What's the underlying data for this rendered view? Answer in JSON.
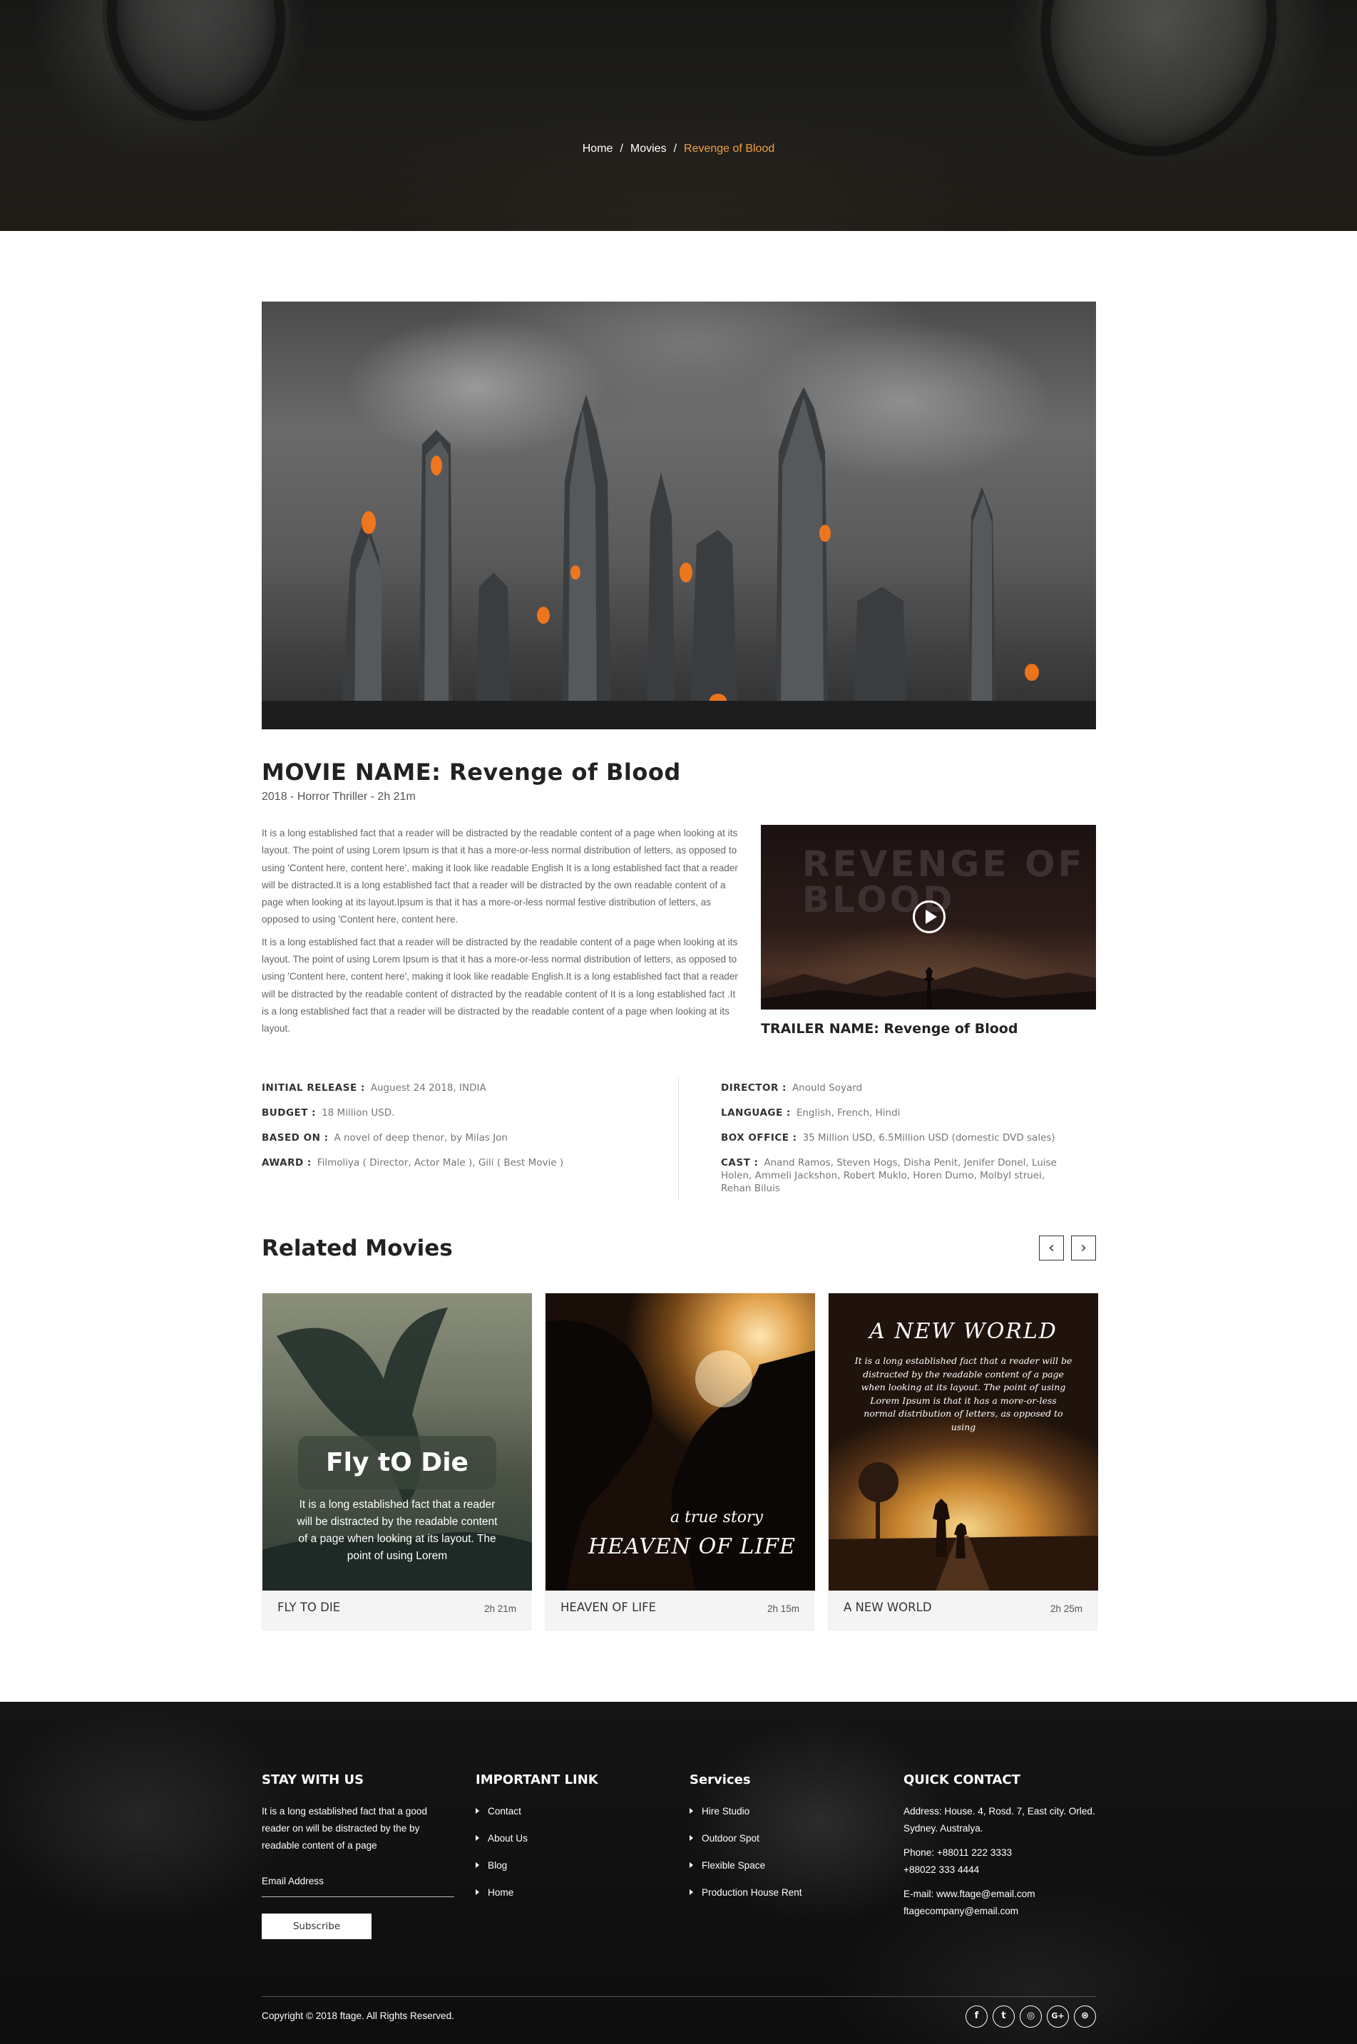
{
  "breadcrumb": {
    "home": "Home",
    "movies": "Movies",
    "current": "Revenge of Blood",
    "separator": "/",
    "active_color": "#f0a040"
  },
  "movie": {
    "title": "MOVIE NAME: Revenge of Blood",
    "meta": "2018 - Horror Thriller - 2h 21m",
    "description": [
      "It is a long established fact that a reader will be distracted by the readable content of a page when looking at its layout. The point of using Lorem Ipsum is that it has a more-or-less normal distribution of letters, as opposed to using 'Content here, content here', making it look like readable English It is a long established fact that a reader will be distracted.It is a long established fact that a reader will be distracted by the own readable content of a page when looking at its layout.Ipsum is that it has a more-or-less normal festive distribution of letters, as opposed to using 'Content here, content here.",
      "It is a long established fact that a reader will be distracted by the readable content of a page when looking at its layout. The point of using Lorem Ipsum is that it has a more-or-less normal distribution of letters, as opposed to using 'Content here, content here', making it look like readable English.It is a long established fact that a reader will be distracted by the readable content of distracted by the readable content of It is a long established fact .It is a long established fact that a reader will be distracted by the readable content of a page when looking at its layout."
    ],
    "trailer": {
      "overlay_text": "REVENGE OF BLOOD",
      "name": "TRAILER NAME: Revenge of Blood",
      "play_icon": "play-icon"
    },
    "info_left": [
      {
        "label": "INITIAL RELEASE :",
        "value": "Auguest 24 2018, INDIA"
      },
      {
        "label": "BUDGET :",
        "value": "18 Million USD."
      },
      {
        "label": "BASED ON :",
        "value": "A novel of deep thenor, by Milas Jon"
      },
      {
        "label": "AWARD :",
        "value": "Filmoliya ( Director, Actor Male ), Gili ( Best Movie )"
      }
    ],
    "info_right": [
      {
        "label": "DIRECTOR :",
        "value": "Anould Soyard"
      },
      {
        "label": "LANGUAGE :",
        "value": "English, French, Hindi"
      },
      {
        "label": "BOX OFFICE :",
        "value": "35 Million USD, 6.5Million USD (domestic DVD sales)"
      },
      {
        "label": "CAST :",
        "value": "Anand Ramos, Steven Hogs, Disha Penit, Jenifer Donel, Luise Holen, Ammeli Jackshon, Robert Muklo, Horen Dumo, Molbyl struei, Rehan Biluis"
      }
    ]
  },
  "related": {
    "title": "Related Movies",
    "prev_icon": "chevron-left-icon",
    "next_icon": "chevron-right-icon",
    "prev_glyph": "‹",
    "next_glyph": "›",
    "cards": [
      {
        "title": "FLY TO DIE",
        "duration": "2h 21m",
        "poster_title": "Fly tO Die",
        "poster_text": "It is a long established fact that a reader will be distracted by the readable content of a page when looking at its layout. The point of using Lorem"
      },
      {
        "title": "HEAVEN OF LIFE",
        "duration": "2h 15m",
        "poster_tagline": "a true story",
        "poster_title": "HEAVEN OF LIFE"
      },
      {
        "title": "A NEW WORLD",
        "duration": "2h 25m",
        "poster_title": "A NEW WORLD",
        "poster_text": "It is a long established fact that a reader will be distracted by the readable content of a page when looking at its layout. The point of using Lorem Ipsum is that it has a more-or-less normal distribution of letters, as opposed to using"
      }
    ]
  },
  "footer": {
    "stay": {
      "heading": "STAY WITH US",
      "text": "It is a long established fact that a good reader on will be distracted by the by readable content of a page",
      "email_label": "Email Address",
      "subscribe": "Subscribe"
    },
    "links": {
      "heading": "IMPORTANT LINK",
      "items": [
        "Contact",
        "About Us",
        "Blog",
        "Home"
      ]
    },
    "services": {
      "heading": "Services",
      "items": [
        "Hire Studio",
        "Outdoor Spot",
        "Flexible Space",
        "Production House Rent"
      ]
    },
    "contact": {
      "heading": "QUICK CONTACT",
      "address": "Address: House. 4, Rosd. 7, East city. Orled. Sydney. Australya.",
      "phone1": "Phone: +88011 222 3333",
      "phone2": "+88022 333 4444",
      "email1": "E-mail: www.ftage@email.com",
      "email2": "ftagecompany@email.com"
    },
    "copyright": "Copyright © 2018 ftage. All Rights Reserved.",
    "social": [
      {
        "icon": "facebook-icon",
        "glyph": "f"
      },
      {
        "icon": "twitter-icon",
        "glyph": "t"
      },
      {
        "icon": "instagram-icon",
        "glyph": "◎"
      },
      {
        "icon": "google-plus-icon",
        "glyph": "G+"
      },
      {
        "icon": "dribbble-icon",
        "glyph": "⊛"
      }
    ]
  }
}
